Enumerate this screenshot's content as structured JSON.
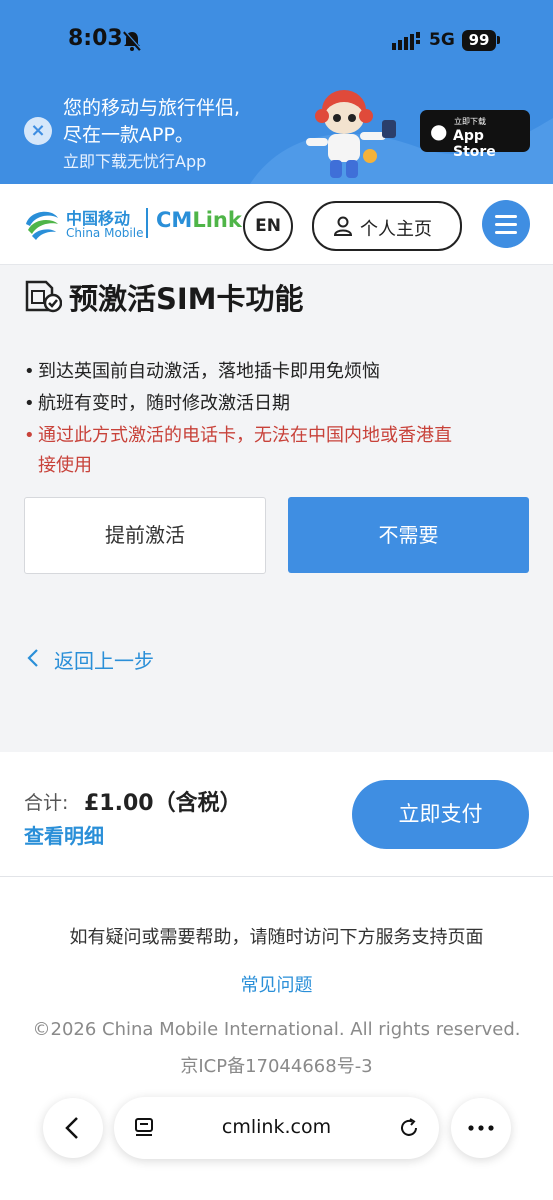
{
  "status_bar": {
    "time": "8:03",
    "network": "5G",
    "battery": "99"
  },
  "banner": {
    "line1": "您的移动与旅行伴侣,",
    "line2": "尽在一款APP。",
    "line3": "立即下载无忧行App",
    "appstore_small": "立即下载",
    "appstore_big": "App Store"
  },
  "header": {
    "logo_cn": "中国移动",
    "logo_en": "China Mobile",
    "logo_cm": "CM",
    "logo_link": "Link",
    "lang_button": "EN",
    "profile_button": "个人主页"
  },
  "main": {
    "title": "预激活SIM卡功能",
    "bullets": [
      "到达英国前自动激活，落地插卡即用免烦恼",
      "航班有变时，随时修改激活日期"
    ],
    "warning_line1": "通过此方式激活的电话卡，无法在中国内地或香港直",
    "warning_line2": "接使用",
    "bullet_dot": "•",
    "activate_button": "提前激活",
    "decline_button": "不需要",
    "back_link": "返回上一步"
  },
  "total": {
    "label": "合计:",
    "value": "£1.00（含税）",
    "detail_link": "查看明细",
    "pay_button": "立即支付"
  },
  "footer": {
    "help": "如有疑问或需要帮助，请随时访问下方服务支持页面",
    "faq": "常见问题",
    "copyright": "©2026 China Mobile International. All rights reserved.",
    "icp": "京ICP备17044668号-3"
  },
  "browser": {
    "url": "cmlink.com"
  },
  "colors": {
    "brand_blue": "#3f8ee2",
    "warning_red": "#c8423a",
    "link_green": "#4fb548"
  }
}
